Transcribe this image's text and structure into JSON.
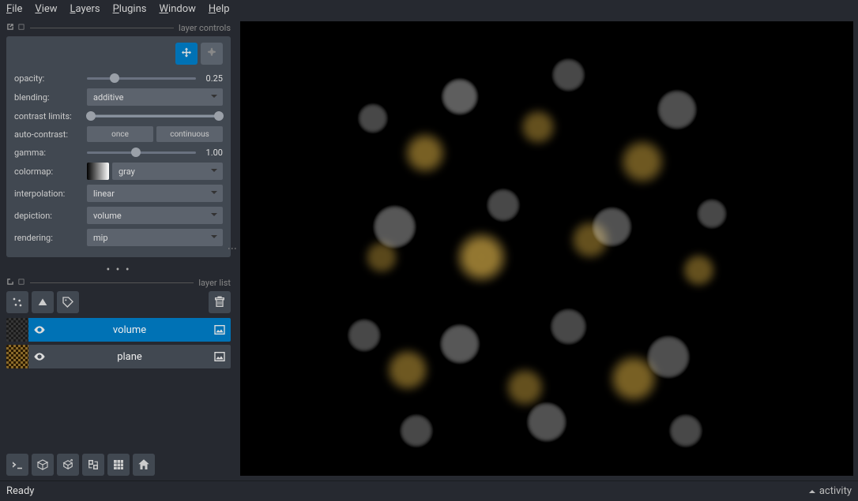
{
  "menu": {
    "file": "File",
    "view": "View",
    "layers": "Layers",
    "plugins": "Plugins",
    "window": "Window",
    "help": "Help"
  },
  "panels": {
    "layer_controls": "layer controls",
    "layer_list": "layer list"
  },
  "controls": {
    "opacity_label": "opacity:",
    "opacity_value": "0.25",
    "blending_label": "blending:",
    "blending_value": "additive",
    "contrast_label": "contrast limits:",
    "auto_contrast_label": "auto-contrast:",
    "auto_once": "once",
    "auto_continuous": "continuous",
    "gamma_label": "gamma:",
    "gamma_value": "1.00",
    "colormap_label": "colormap:",
    "colormap_value": "gray",
    "interpolation_label": "interpolation:",
    "interpolation_value": "linear",
    "depiction_label": "depiction:",
    "depiction_value": "volume",
    "rendering_label": "rendering:",
    "rendering_value": "mip"
  },
  "layers": [
    {
      "name": "volume",
      "selected": true
    },
    {
      "name": "plane",
      "selected": false
    }
  ],
  "status": {
    "ready": "Ready",
    "activity": "activity"
  }
}
